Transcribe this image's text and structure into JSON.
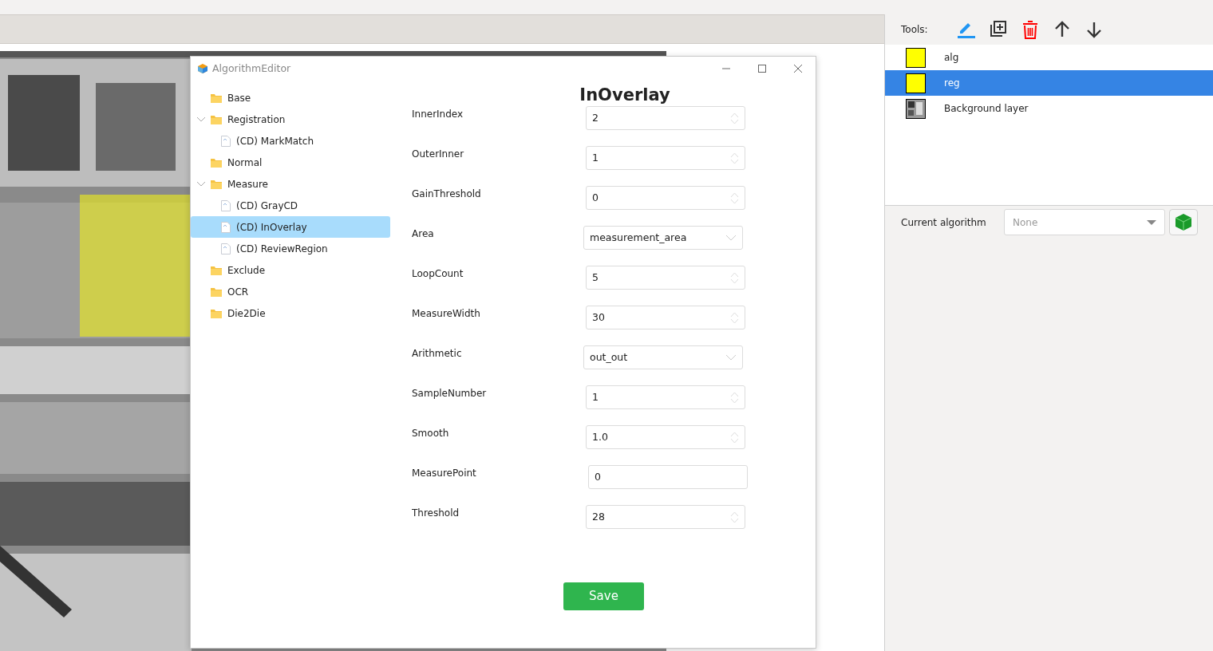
{
  "window": {
    "title": "AlgorithmEditor"
  },
  "tree": [
    {
      "label": "Base",
      "kind": "folder",
      "selected": false
    },
    {
      "label": "Registration",
      "kind": "folder",
      "selected": false,
      "expanded": true,
      "children": [
        {
          "label": "(CD) MarkMatch",
          "kind": "file",
          "selected": false
        }
      ]
    },
    {
      "label": "Normal",
      "kind": "folder",
      "selected": false
    },
    {
      "label": "Measure",
      "kind": "folder",
      "selected": false,
      "expanded": true,
      "children": [
        {
          "label": "(CD) GrayCD",
          "kind": "file",
          "selected": false
        },
        {
          "label": "(CD) InOverlay",
          "kind": "file",
          "selected": true
        },
        {
          "label": "(CD) ReviewRegion",
          "kind": "file",
          "selected": false
        }
      ]
    },
    {
      "label": "Exclude",
      "kind": "folder",
      "selected": false
    },
    {
      "label": "OCR",
      "kind": "folder",
      "selected": false
    },
    {
      "label": "Die2Die",
      "kind": "folder",
      "selected": false
    }
  ],
  "form": {
    "title": "InOverlay",
    "fields": [
      {
        "label": "InnerIndex",
        "kind": "spin",
        "value": "2"
      },
      {
        "label": "OuterInner",
        "kind": "spin",
        "value": "1"
      },
      {
        "label": "GainThreshold",
        "kind": "spin",
        "value": "0"
      },
      {
        "label": "Area",
        "kind": "select",
        "value": "measurement_area"
      },
      {
        "label": "LoopCount",
        "kind": "spin",
        "value": "5"
      },
      {
        "label": "MeasureWidth",
        "kind": "spin",
        "value": "30"
      },
      {
        "label": "Arithmetic",
        "kind": "select",
        "value": "out_out"
      },
      {
        "label": "SampleNumber",
        "kind": "spin",
        "value": "1"
      },
      {
        "label": "Smooth",
        "kind": "spin",
        "value": "1.0"
      },
      {
        "label": "MeasurePoint",
        "kind": "text",
        "value": "0"
      },
      {
        "label": "Threshold",
        "kind": "spin",
        "value": "28"
      }
    ],
    "save_button": "Save"
  },
  "tools": {
    "label": "Tools:"
  },
  "layers": [
    {
      "name": "alg",
      "kind": "swatch",
      "color": "#ffff00",
      "selected": false
    },
    {
      "name": "reg",
      "kind": "swatch",
      "color": "#ffff00",
      "selected": true
    },
    {
      "name": "Background layer",
      "selected": false
    }
  ],
  "current_algorithm": {
    "label": "Current algorithm",
    "placeholder": "None"
  }
}
